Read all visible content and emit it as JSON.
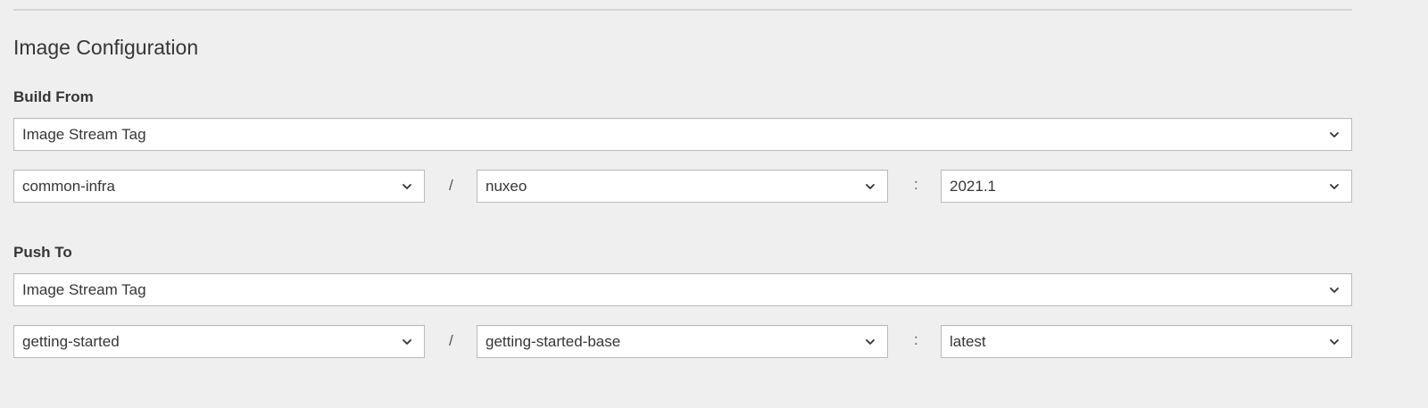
{
  "section": {
    "title": "Image Configuration"
  },
  "build_from": {
    "label": "Build From",
    "type_select": "Image Stream Tag",
    "namespace": "common-infra",
    "separator_slash": "/",
    "image_stream": "nuxeo",
    "separator_colon": ":",
    "tag": "2021.1"
  },
  "push_to": {
    "label": "Push To",
    "type_select": "Image Stream Tag",
    "namespace": "getting-started",
    "separator_slash": "/",
    "image_stream": "getting-started-base",
    "separator_colon": ":",
    "tag": "latest"
  },
  "icons": {
    "select_caret": "chevron-down-icon"
  }
}
